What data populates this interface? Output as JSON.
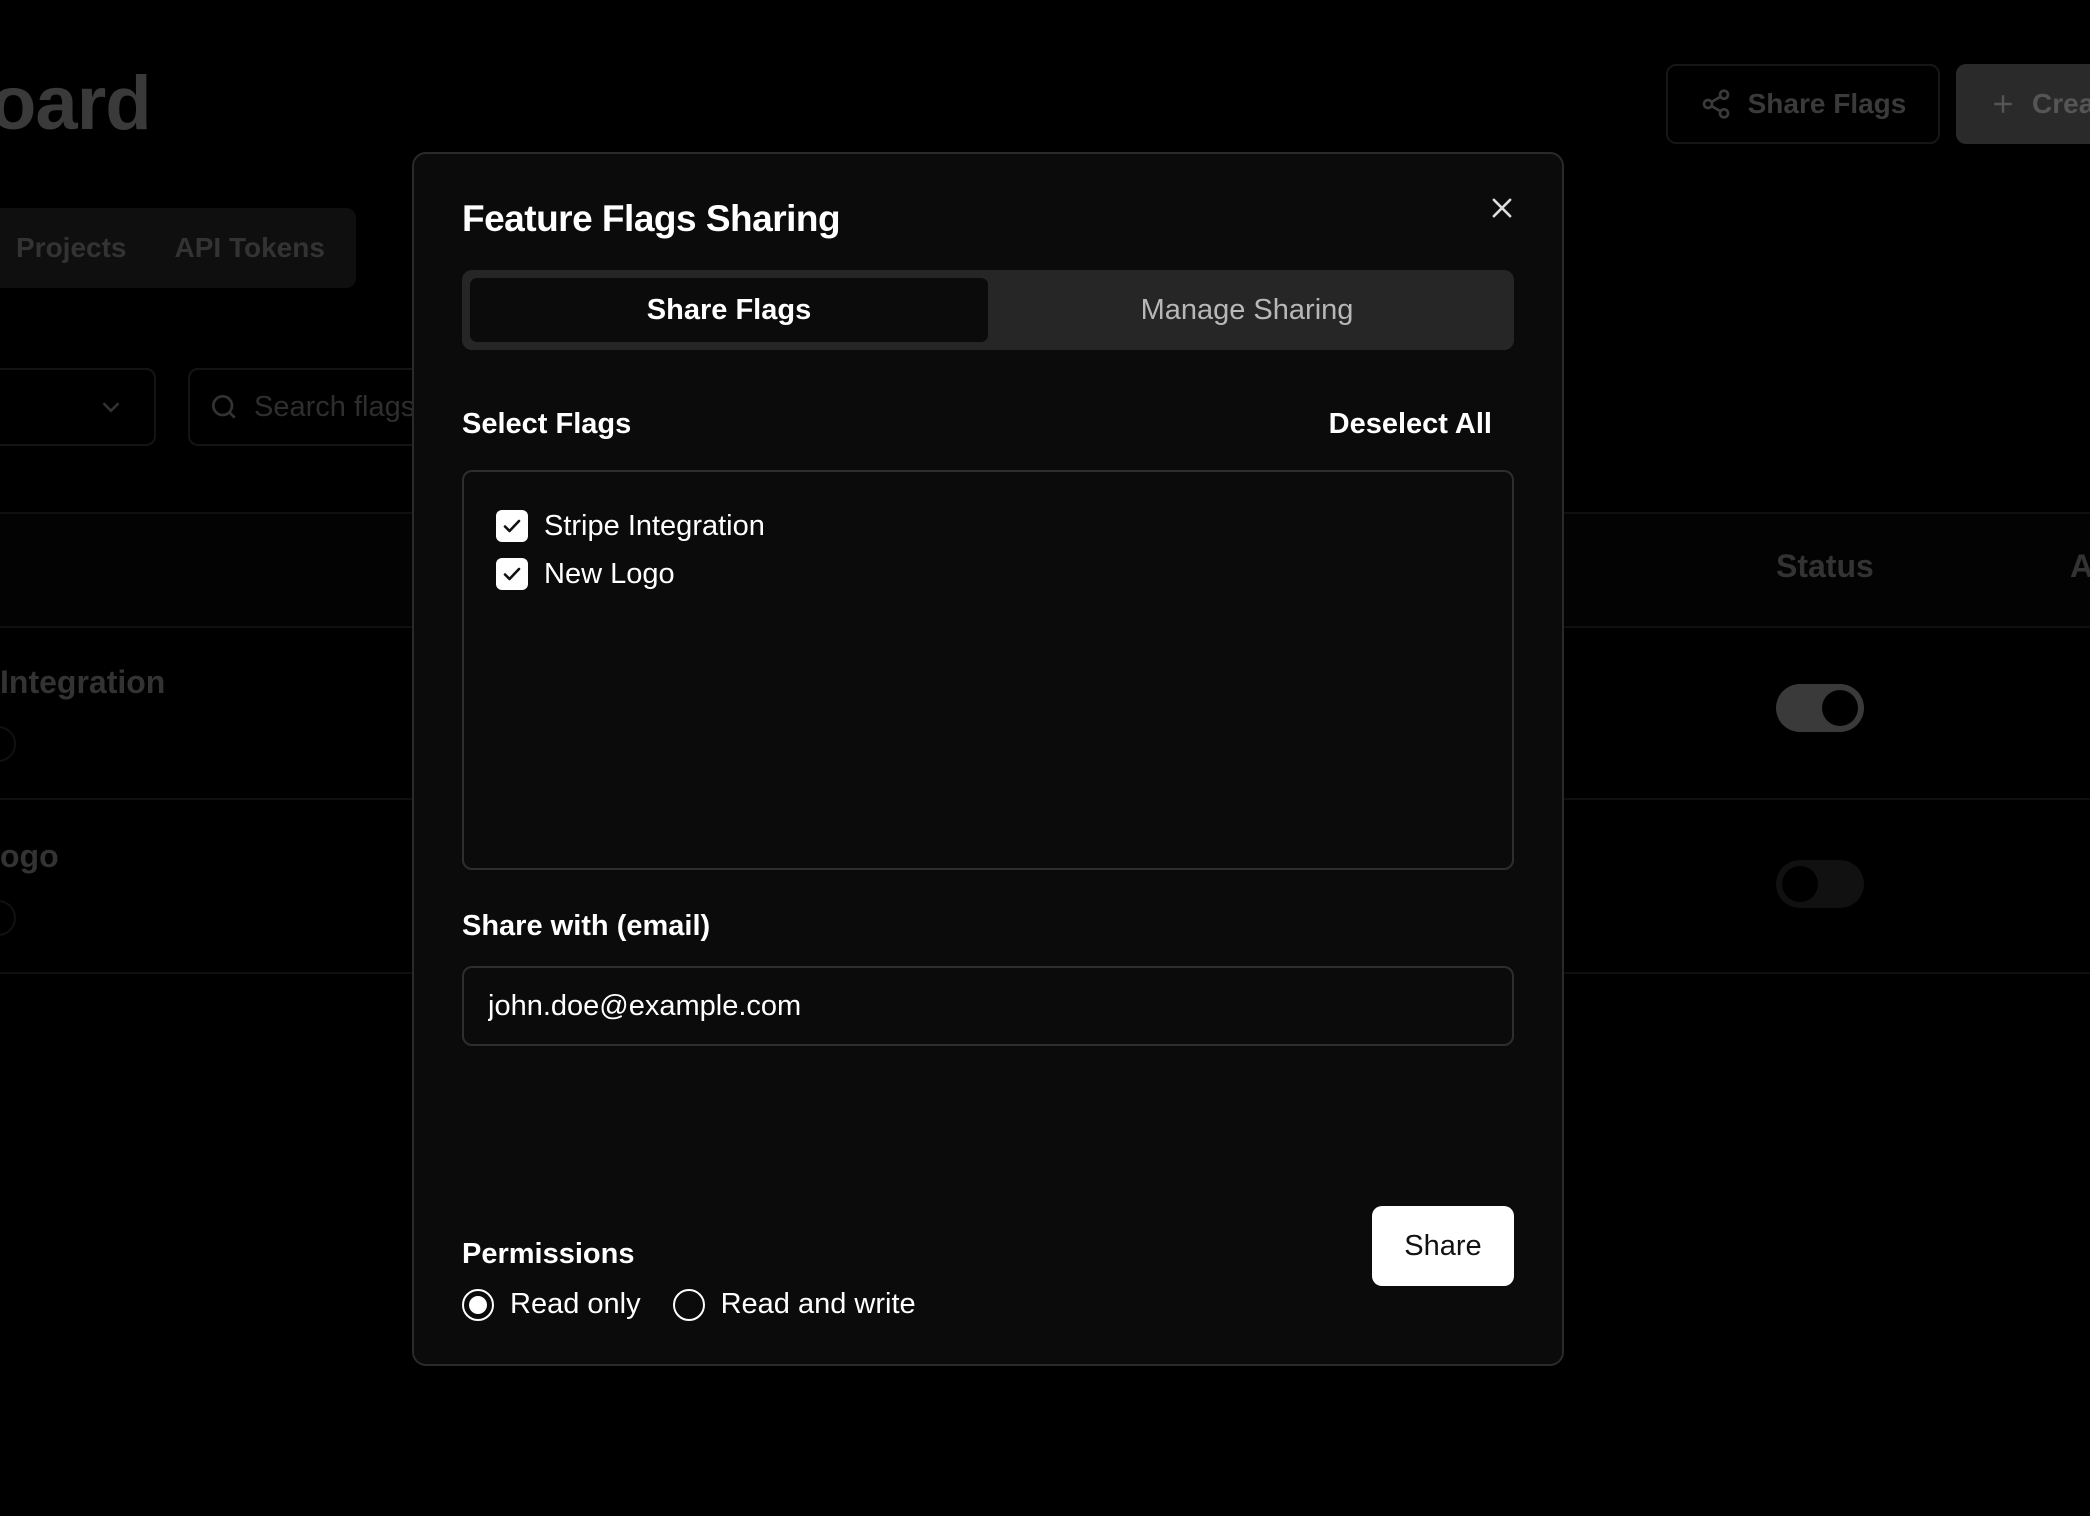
{
  "background": {
    "title": "oard",
    "tabs": [
      "Projects",
      "API Tokens"
    ],
    "search_placeholder": "Search flags",
    "share_flags_label": "Share Flags",
    "create_label": "Crea",
    "status_header": "Status",
    "extra_header": "A",
    "rows": [
      {
        "name": "Integration",
        "enabled": true
      },
      {
        "name": "ogo",
        "enabled": false
      }
    ]
  },
  "modal": {
    "title": "Feature Flags Sharing",
    "tabs": [
      {
        "label": "Share Flags",
        "active": true
      },
      {
        "label": "Manage Sharing",
        "active": false
      }
    ],
    "select_flags_label": "Select Flags",
    "deselect_all_label": "Deselect All",
    "flags": [
      {
        "label": "Stripe Integration",
        "checked": true
      },
      {
        "label": "New Logo",
        "checked": true
      }
    ],
    "share_with_label": "Share with (email)",
    "email_value": "john.doe@example.com",
    "permissions_label": "Permissions",
    "permissions": [
      {
        "label": "Read only",
        "selected": true
      },
      {
        "label": "Read and write",
        "selected": false
      }
    ],
    "share_button_label": "Share"
  },
  "colors": {
    "modal_bg": "#0b0b0b",
    "tab_track": "#262626",
    "primary_button": "#ffffff"
  }
}
